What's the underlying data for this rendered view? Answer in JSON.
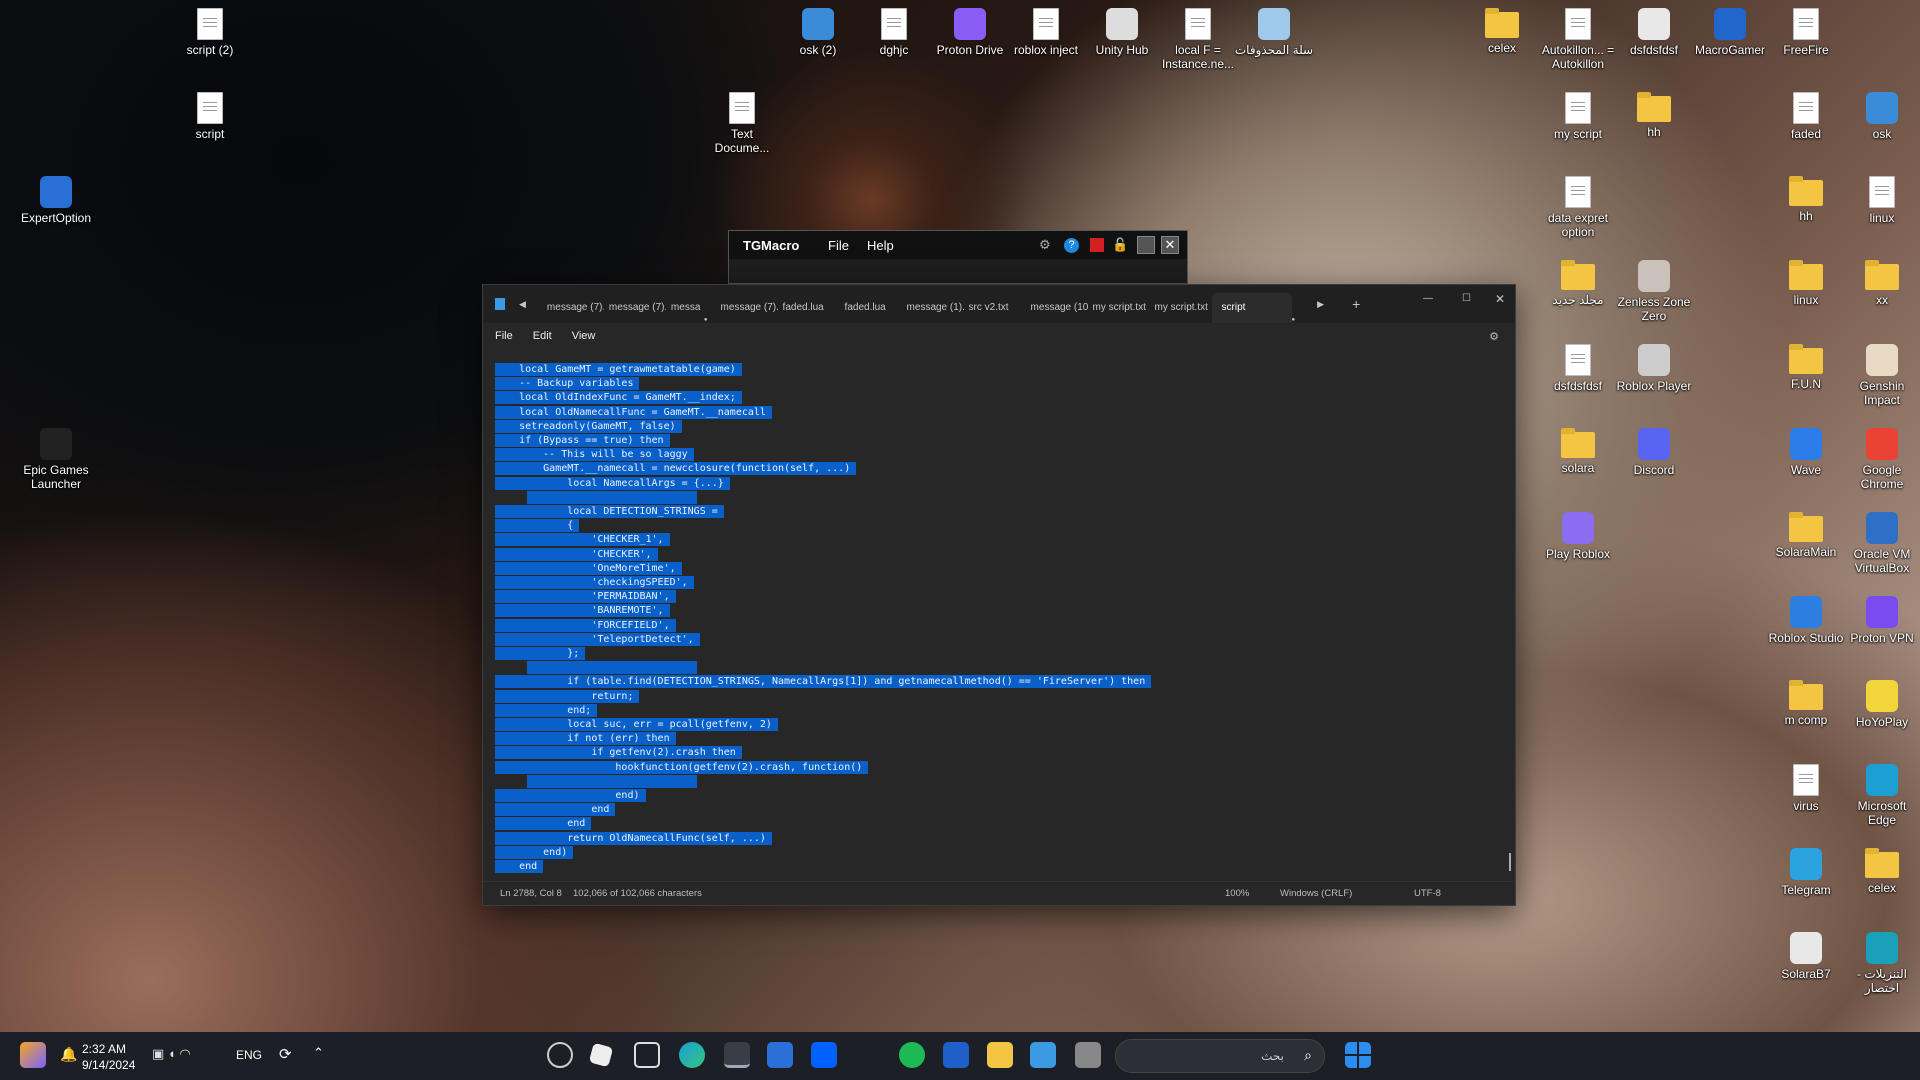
{
  "desktop": {
    "icons": [
      {
        "label": "script (2)",
        "type": "doc"
      },
      {
        "label": "script",
        "type": "doc"
      },
      {
        "label": "ExpertOption",
        "type": "app",
        "color": "#2a6fd6"
      },
      {
        "label": "Epic Games Launcher",
        "type": "app",
        "color": "#222"
      },
      {
        "label": "osk (2)",
        "type": "app",
        "color": "#3a8bd8"
      },
      {
        "label": "dghjc",
        "type": "doc"
      },
      {
        "label": "Proton Drive",
        "type": "app",
        "color": "#8a5cf6"
      },
      {
        "label": "roblox inject",
        "type": "doc"
      },
      {
        "label": "Unity Hub",
        "type": "app",
        "color": "#ddd"
      },
      {
        "label": "local F = Instance.ne...",
        "type": "doc"
      },
      {
        "label": "سلة المحذوفات",
        "type": "app",
        "color": "#9ec9ea"
      },
      {
        "label": "Text Docume...",
        "type": "doc"
      },
      {
        "label": "celex",
        "type": "fold"
      },
      {
        "label": "Autokillon... = Autokillon",
        "type": "doc"
      },
      {
        "label": "dsfdsfdsf",
        "type": "app",
        "color": "#e8e8e8"
      },
      {
        "label": "MacroGamer",
        "type": "app",
        "color": "#2266cc"
      },
      {
        "label": "FreeFire",
        "type": "doc"
      },
      {
        "label": "my script",
        "type": "doc"
      },
      {
        "label": "hh",
        "type": "fold"
      },
      {
        "label": "faded",
        "type": "doc"
      },
      {
        "label": "osk",
        "type": "app",
        "color": "#3a8bd8"
      },
      {
        "label": "data expret option",
        "type": "doc"
      },
      {
        "label": "hh",
        "type": "fold"
      },
      {
        "label": "linux",
        "type": "doc"
      },
      {
        "label": "مجلد جديد",
        "type": "fold"
      },
      {
        "label": "Zenless Zone Zero",
        "type": "app",
        "color": "#c9c2bb"
      },
      {
        "label": "linux",
        "type": "fold"
      },
      {
        "label": "xx",
        "type": "fold"
      },
      {
        "label": "dsfdsfdsf",
        "type": "doc"
      },
      {
        "label": "Roblox Player",
        "type": "app",
        "color": "#ccc"
      },
      {
        "label": "F.U.N",
        "type": "fold"
      },
      {
        "label": "Genshin Impact",
        "type": "app",
        "color": "#e8d9c4"
      },
      {
        "label": "solara",
        "type": "fold"
      },
      {
        "label": "Discord",
        "type": "app",
        "color": "#5865f2"
      },
      {
        "label": "Wave",
        "type": "app",
        "color": "#2b7de9"
      },
      {
        "label": "Google Chrome",
        "type": "app",
        "color": "#e94335"
      },
      {
        "label": "Play Roblox",
        "type": "app",
        "color": "#8a6df0"
      },
      {
        "label": "SolaraMain",
        "type": "fold"
      },
      {
        "label": "Oracle VM VirtualBox",
        "type": "app",
        "color": "#2f6fc5"
      },
      {
        "label": "Roblox Studio",
        "type": "app",
        "color": "#2a7fe0"
      },
      {
        "label": "Proton VPN",
        "type": "app",
        "color": "#7a4cf0"
      },
      {
        "label": "m comp",
        "type": "fold"
      },
      {
        "label": "HoYoPlay",
        "type": "app",
        "color": "#f2d53a"
      },
      {
        "label": "virus",
        "type": "doc"
      },
      {
        "label": "Microsoft Edge",
        "type": "app",
        "color": "#1ca0d4"
      },
      {
        "label": "Telegram",
        "type": "app",
        "color": "#2aa3e0"
      },
      {
        "label": "celex",
        "type": "fold"
      },
      {
        "label": "SolaraB7",
        "type": "app",
        "color": "#e8e8e8"
      },
      {
        "label": "التنزيلات - اختصار",
        "type": "app",
        "color": "#1aa0b8"
      }
    ]
  },
  "tgmacro": {
    "title": "TGMacro",
    "menu": [
      "File",
      "Help"
    ]
  },
  "notepad": {
    "tabs": [
      "message (7).",
      "message (7).",
      "messa",
      "message (7).",
      "faded.lua",
      "faded.lua",
      "message (1).",
      "src v2.txt",
      "message (10",
      "my script.txt",
      "my script.txt",
      "script"
    ],
    "menu": [
      "File",
      "Edit",
      "View"
    ],
    "code": [
      "    local GameMT = getrawmetatable(game)",
      "    -- Backup variables",
      "    local OldIndexFunc = GameMT.__index;",
      "    local OldNamecallFunc = GameMT.__namecall",
      "    setreadonly(GameMT, false)",
      "    if (Bypass == true) then",
      "        -- This will be so laggy",
      "        GameMT.__namecall = newcclosure(function(self, ...)",
      "            local NamecallArgs = {...}",
      "",
      "            local DETECTION_STRINGS =",
      "            {",
      "                'CHECKER_1',",
      "                'CHECKER',",
      "                'OneMoreTime',",
      "                'checkingSPEED',",
      "                'PERMAIDBAN',",
      "                'BANREMOTE',",
      "                'FORCEFIELD',",
      "                'TeleportDetect',",
      "            };",
      "",
      "            if (table.find(DETECTION_STRINGS, NamecallArgs[1]) and getnamecallmethod() == 'FireServer') then",
      "                return;",
      "            end;",
      "            local suc, err = pcall(getfenv, 2)",
      "            if not (err) then",
      "                if getfenv(2).crash then",
      "                    hookfunction(getfenv(2).crash, function()",
      "",
      "                    end)",
      "                end",
      "            end",
      "            return OldNamecallFunc(self, ...)",
      "        end)",
      "    end"
    ],
    "status": {
      "position": "Ln 2788, Col 8",
      "chars": "102,066 of 102,066 characters",
      "zoom": "100%",
      "eol": "Windows (CRLF)",
      "encoding": "UTF-8"
    }
  },
  "taskbar": {
    "time": "2:32 AM",
    "date": "9/14/2024",
    "lang": "ENG",
    "search_placeholder": "بحث"
  }
}
